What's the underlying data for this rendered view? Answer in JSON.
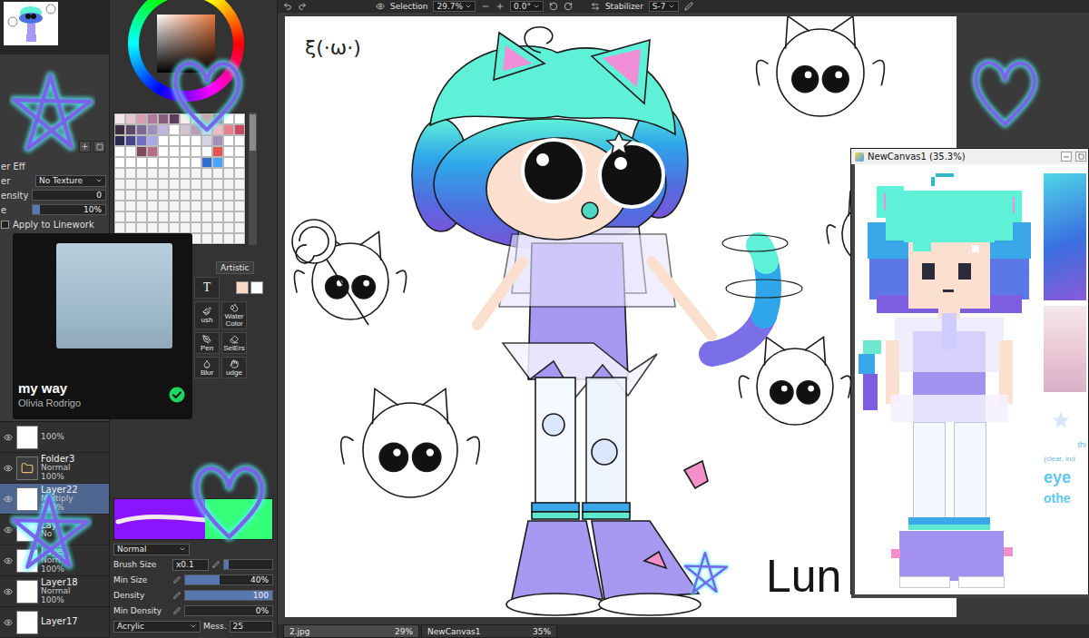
{
  "toolbar": {
    "selection": "Selection",
    "zoom": "29.7%",
    "angle": "0.0°",
    "stabilizer_label": "Stabilizer",
    "stabilizer": "S-7"
  },
  "brush_effects": [
    {
      "kind": "label",
      "label": "er Eff"
    },
    {
      "kind": "select",
      "label": "er",
      "value": "No Texture"
    },
    {
      "kind": "slider",
      "label": "ensity",
      "value": "0",
      "level": 0
    },
    {
      "kind": "slider",
      "label": "e",
      "value": "10%",
      "level": 0.1
    },
    {
      "kind": "check",
      "label": "Apply to Linework",
      "checked": false
    }
  ],
  "layers": [
    {
      "kind": "layer",
      "name": "",
      "mode": "",
      "opacity": "100%",
      "selected": false,
      "visible": true
    },
    {
      "kind": "folder",
      "name": "Folder3",
      "mode": "Normal",
      "opacity": "100%",
      "selected": false,
      "visible": true
    },
    {
      "kind": "layer",
      "name": "Layer22",
      "mode": "Multiply",
      "opacity": "100%",
      "selected": true,
      "visible": true
    },
    {
      "kind": "layer",
      "name": "Lay",
      "mode": "No",
      "opacity": "",
      "selected": false,
      "visible": true
    },
    {
      "kind": "layer",
      "name": "Layer",
      "mode": "Normal",
      "opacity": "100%",
      "selected": false,
      "visible": true
    },
    {
      "kind": "layer",
      "name": "Layer18",
      "mode": "Normal",
      "opacity": "100%",
      "selected": false,
      "visible": true
    },
    {
      "kind": "layer",
      "name": "Layer17",
      "mode": "",
      "opacity": "",
      "selected": false,
      "visible": true
    }
  ],
  "color_panel": {
    "primary": "#fbd9c9",
    "secondary": "#ffffff"
  },
  "swatches": {
    "colors": [
      "#f2e6ea",
      "#e8c6d0",
      "#d89fb1",
      "#b0789a",
      "#8b5a7c",
      "#5e3d5a",
      "#f6efe8",
      "#e7d2c4",
      "#caa9a0",
      "#a07f7f",
      "#ffffff",
      "#ffffff",
      "#3d2b3f",
      "#5b4766",
      "#7c6a93",
      "#9f8fbb",
      "#c3b6dc",
      "#ffffff",
      "#d2c3d1",
      "#b79eb6",
      "#e9d6d8",
      "#f2b9c0",
      "#e8808f",
      "#c84a63",
      "#2e2b52",
      "#46448a",
      "#6e6fc4",
      "#a8a9e8",
      "#ffffff",
      "#ffffff",
      "#ffffff",
      "#ffffff",
      "#d9d0e3",
      "#a48fb8",
      "#ffffff",
      "#ffffff",
      "#ffffff",
      "#ffffff",
      "#7d4a5c",
      "#b76d84",
      "#ffffff",
      "#ffffff",
      "#ffffff",
      "#ffffff",
      "#ffffff",
      "#e4534f",
      "#ffffff",
      "#ffffff",
      "#ffffff",
      "#ffffff",
      "#ffffff",
      "#ffffff",
      "#ffffff",
      "#ffffff",
      "#ffffff",
      "#ffffff",
      "#2d6fd1",
      "#4aa3ff",
      "#ffffff",
      "#ffffff"
    ],
    "empty": 84
  },
  "tool_tabs": [
    {
      "label": "Artistic",
      "selected": false
    }
  ],
  "tools": [
    {
      "label": "T",
      "selected": false
    },
    {
      "label": "ush",
      "selected": false
    },
    {
      "label": "Water Color",
      "selected": false
    },
    {
      "label": "Pen",
      "selected": false
    },
    {
      "label": "SelErs",
      "selected": false
    },
    {
      "label": "Blur",
      "selected": false
    },
    {
      "label": "udge",
      "selected": false
    }
  ],
  "brush_settings": {
    "main_color": "#8a14ff",
    "sub_color": "#35ff78",
    "blend": "Normal",
    "rows": [
      {
        "kind": "size",
        "label": "Brush Size",
        "value": "x0.1",
        "level": 0.1
      },
      {
        "kind": "slider",
        "label": "Min Size",
        "value": "40%",
        "level": 0.4
      },
      {
        "kind": "slider",
        "label": "Density",
        "value": "100",
        "level": 1
      },
      {
        "kind": "slider",
        "label": "Min Density",
        "value": "0%",
        "level": 0
      }
    ],
    "texture": "Acrylic",
    "mess_label": "Mess.",
    "mess": "25"
  },
  "canvas": {
    "kaomoji": "ξ(·ω·)",
    "signature": "Lun"
  },
  "player": {
    "title": "my way",
    "artist": "Olivia Rodrigo",
    "saved": true
  },
  "subwindow": {
    "title": "NewCanvas1 (35.3%)",
    "notes": [
      "thi",
      "(clear, ind",
      "eye",
      "othe"
    ]
  },
  "document_tabs": [
    {
      "name": "2.jpg",
      "zoom": "29%",
      "selected": true
    },
    {
      "name": "NewCanvas1",
      "zoom": "35%",
      "selected": false
    }
  ]
}
